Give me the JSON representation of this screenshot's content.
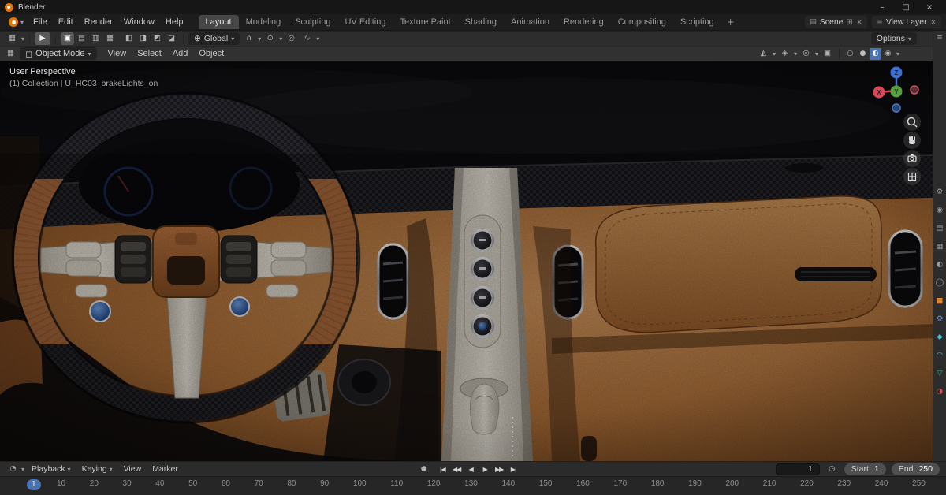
{
  "ui": {
    "caret": "▾",
    "close": "×"
  },
  "colors": {
    "accent": "#4772b3",
    "leather": "#b5713f",
    "carbon": "#1e1e21",
    "ivory": "#ddd8ce"
  },
  "titlebar": {
    "title": "Blender",
    "minimize_glyph": "–",
    "maximize_glyph": "□",
    "close_glyph": "×"
  },
  "menubar": {
    "menus": [
      {
        "name": "menu-file",
        "label": "File"
      },
      {
        "name": "menu-edit",
        "label": "Edit"
      },
      {
        "name": "menu-render",
        "label": "Render"
      },
      {
        "name": "menu-window",
        "label": "Window"
      },
      {
        "name": "menu-help",
        "label": "Help"
      }
    ],
    "workspaces": [
      {
        "name": "tab-layout",
        "label": "Layout",
        "active": true
      },
      {
        "name": "tab-modeling",
        "label": "Modeling"
      },
      {
        "name": "tab-sculpting",
        "label": "Sculpting"
      },
      {
        "name": "tab-uv-editing",
        "label": "UV Editing"
      },
      {
        "name": "tab-texture-paint",
        "label": "Texture Paint"
      },
      {
        "name": "tab-shading",
        "label": "Shading"
      },
      {
        "name": "tab-animation",
        "label": "Animation"
      },
      {
        "name": "tab-rendering",
        "label": "Rendering"
      },
      {
        "name": "tab-compositing",
        "label": "Compositing"
      },
      {
        "name": "tab-scripting",
        "label": "Scripting"
      }
    ],
    "add_workspace_glyph": "+",
    "scene_selector": {
      "icon_glyph": "▤",
      "label": "Scene",
      "new_glyph": "⊞",
      "unlink_glyph": "×"
    },
    "view_layer_selector": {
      "icon_glyph": "≡",
      "label": "View Layer",
      "unlink_glyph": "×"
    }
  },
  "tool_header": {
    "editor_icon_glyph": "▦",
    "active_tool_glyph": "▶",
    "select_mode_icons": [
      {
        "name": "select-set-icon",
        "glyph": "▣",
        "active": true
      },
      {
        "name": "select-extend-icon",
        "glyph": "▤"
      },
      {
        "name": "select-subtract-icon",
        "glyph": "▥"
      },
      {
        "name": "select-intersect-icon",
        "glyph": "▦"
      }
    ],
    "tool_option_icons": [
      {
        "name": "tool-option-icon-1",
        "glyph": "◧"
      },
      {
        "name": "tool-option-icon-2",
        "glyph": "◨"
      },
      {
        "name": "tool-option-icon-3",
        "glyph": "◩"
      },
      {
        "name": "tool-option-icon-4",
        "glyph": "◪"
      }
    ],
    "orientation_icon_glyph": "⊕",
    "orientation_label": "Global",
    "snap_icon_glyph": "∩",
    "snap_target_icon_glyph": "⊙",
    "proportional_icon_glyph": "◎",
    "falloff_icon_glyph": "∿",
    "options_label": "Options"
  },
  "viewport_header": {
    "editor_icon_glyph": "▦",
    "mode_icon_glyph": "◻",
    "mode_label": "Object Mode",
    "menus": [
      {
        "name": "menu-view",
        "label": "View"
      },
      {
        "name": "menu-select",
        "label": "Select"
      },
      {
        "name": "menu-add",
        "label": "Add"
      },
      {
        "name": "menu-object",
        "label": "Object"
      }
    ],
    "visibility_icon_glyph": "◭",
    "gizmo_icon_glyph": "◈",
    "overlays_icon_glyph": "◎",
    "xray_icon_glyph": "▣",
    "shading_modes": [
      {
        "name": "shading-wireframe-icon",
        "glyph": "○"
      },
      {
        "name": "shading-solid-icon",
        "glyph": "●"
      },
      {
        "name": "shading-material-icon",
        "glyph": "◐",
        "active": true
      },
      {
        "name": "shading-rendered-icon",
        "glyph": "◉"
      }
    ]
  },
  "viewport": {
    "overlay_line1": "User Perspective",
    "overlay_line2": "(1) Collection | U_HC03_brakeLights_on",
    "gizmo_axes": {
      "x": "X",
      "y": "Y",
      "z": "Z"
    }
  },
  "properties_strip": {
    "editor_icon_glyph": "≡",
    "tabs": [
      {
        "name": "tab-tool",
        "glyph": "⚙",
        "color": "#9a9a9a"
      },
      {
        "name": "tab-render",
        "glyph": "◉",
        "color": "#9a9a9a"
      },
      {
        "name": "tab-output",
        "glyph": "▤",
        "color": "#9a9a9a"
      },
      {
        "name": "tab-view-layer",
        "glyph": "▦",
        "color": "#9a9a9a"
      },
      {
        "name": "tab-scene",
        "glyph": "◐",
        "color": "#9a9a9a"
      },
      {
        "name": "tab-world",
        "glyph": "◯",
        "color": "#9a9a9a"
      },
      {
        "name": "tab-object",
        "glyph": "■",
        "color": "#e0862d"
      },
      {
        "name": "tab-modifiers",
        "glyph": "⚙",
        "color": "#5a8fd4"
      },
      {
        "name": "tab-particles",
        "glyph": "◆",
        "color": "#4fb8c9"
      },
      {
        "name": "tab-physics",
        "glyph": "◠",
        "color": "#4fb8c9"
      },
      {
        "name": "tab-object-data",
        "glyph": "▽",
        "color": "#46a46c"
      },
      {
        "name": "tab-material",
        "glyph": "◑",
        "color": "#d0524d"
      }
    ]
  },
  "timeline": {
    "editor_icon_glyph": "◔",
    "menus": [
      {
        "name": "menu-playback",
        "label": "Playback",
        "caret": "▾"
      },
      {
        "name": "menu-keying",
        "label": "Keying",
        "caret": "▾"
      },
      {
        "name": "menu-view",
        "label": "View",
        "caret": ""
      },
      {
        "name": "menu-marker",
        "label": "Marker",
        "caret": ""
      }
    ],
    "autokey_glyph": "●",
    "transport": [
      {
        "name": "jump-to-start-button",
        "glyph": "|◀"
      },
      {
        "name": "prev-keyframe-button",
        "glyph": "◀◀"
      },
      {
        "name": "play-reverse-button",
        "glyph": "◀"
      },
      {
        "name": "play-button",
        "glyph": "▶"
      },
      {
        "name": "next-keyframe-button",
        "glyph": "▶▶"
      },
      {
        "name": "jump-to-end-button",
        "glyph": "▶|"
      }
    ],
    "frame_value": "1",
    "preview_range_glyph": "◷",
    "start_label": "Start",
    "start_value": "1",
    "end_label": "End",
    "end_value": "250",
    "current_frame_badge": "1",
    "ruler_ticks": [
      10,
      20,
      30,
      40,
      50,
      60,
      70,
      80,
      90,
      100,
      110,
      120,
      130,
      140,
      150,
      160,
      170,
      180,
      190,
      200,
      210,
      220,
      230,
      240,
      250
    ]
  }
}
